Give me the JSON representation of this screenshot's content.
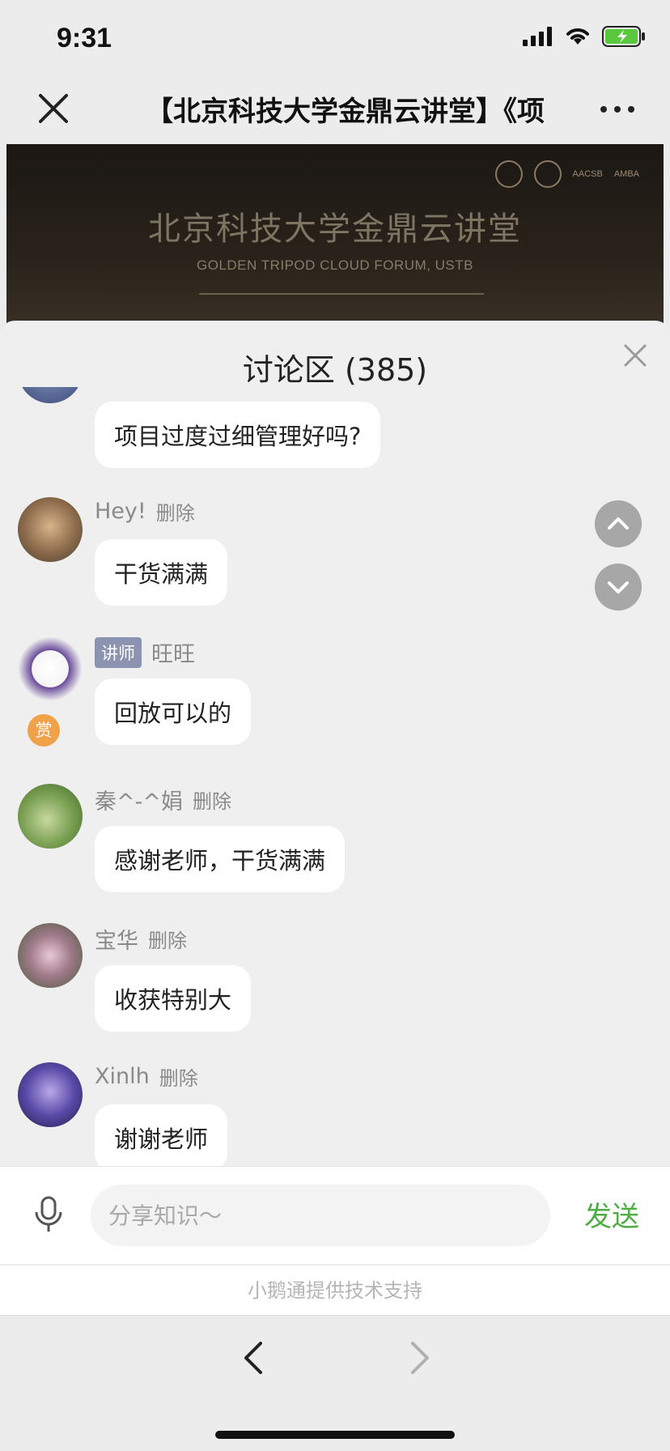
{
  "status": {
    "time": "9:31"
  },
  "nav": {
    "title": "【北京科技大学金鼎云讲堂】《项"
  },
  "banner": {
    "title": "北京科技大学金鼎云讲堂",
    "subtitle": "GOLDEN TRIPOD CLOUD FORUM, USTB",
    "logo_labels": [
      "AACSB",
      "AMBA"
    ]
  },
  "panel": {
    "title": "讨论区 (385)"
  },
  "messages": [
    {
      "name": "",
      "text": "项目过度过细管理好吗?",
      "delete": ""
    },
    {
      "name": "Hey!",
      "text": "干货满满",
      "delete": "删除"
    },
    {
      "name": "旺旺",
      "badge": "讲师",
      "reward": "赏",
      "text": "回放可以的",
      "delete": ""
    },
    {
      "name": "秦^-^娟",
      "text": "感谢老师，干货满满",
      "delete": "删除"
    },
    {
      "name": "宝华",
      "text": "收获特别大",
      "delete": "删除"
    },
    {
      "name": "Xinlh",
      "text": "谢谢老师",
      "delete": "删除"
    }
  ],
  "input": {
    "placeholder": "分享知识～",
    "send_label": "发送"
  },
  "footer": {
    "powered_by": "小鹅通提供技术支持"
  },
  "colors": {
    "send_green": "#4fae43",
    "teacher_badge": "#8c93b0",
    "reward_orange": "#f0a24a"
  }
}
